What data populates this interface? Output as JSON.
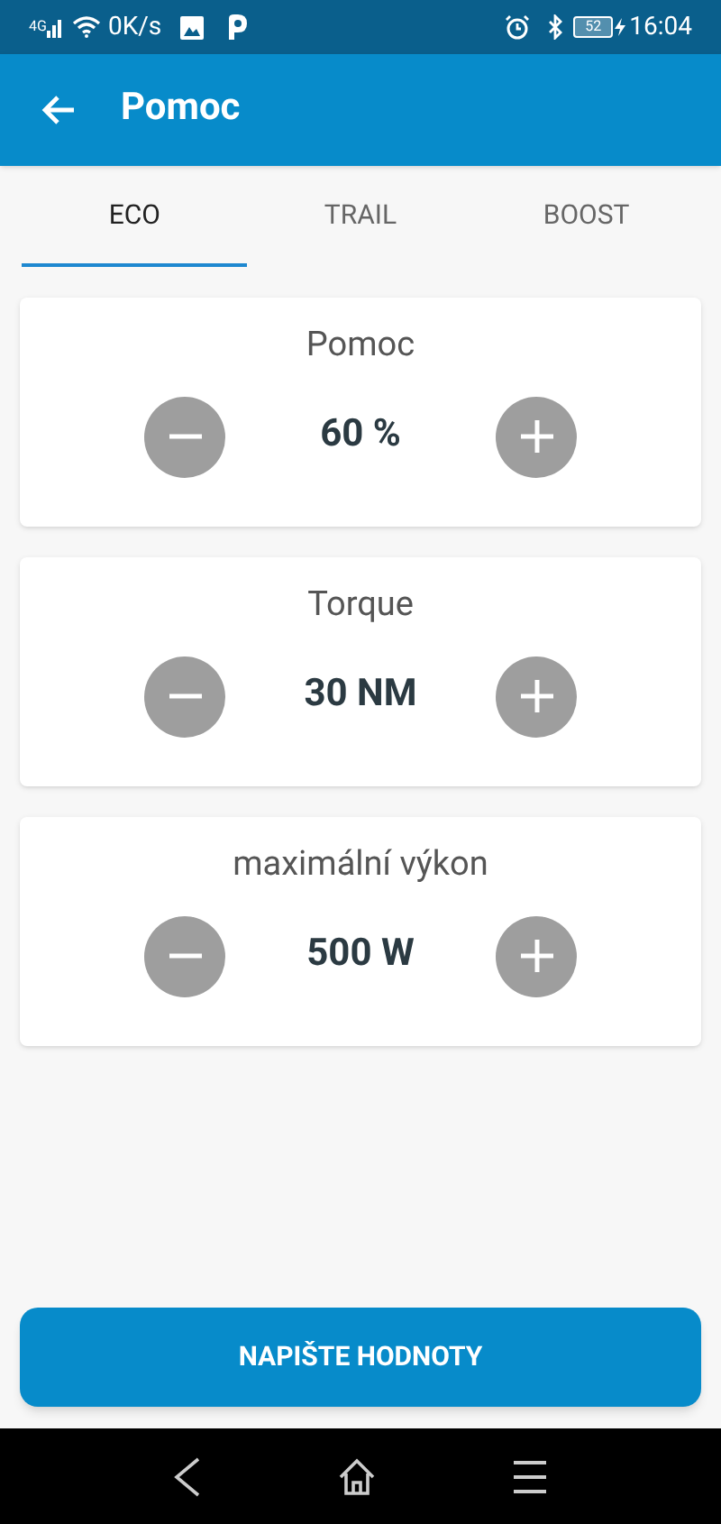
{
  "status_bar": {
    "network": "4G",
    "speed": "0K/s",
    "battery": "52",
    "time": "16:04"
  },
  "app_bar": {
    "title": "Pomoc"
  },
  "tabs": [
    {
      "label": "ECO",
      "selected": true
    },
    {
      "label": "TRAIL",
      "selected": false
    },
    {
      "label": "BOOST",
      "selected": false
    }
  ],
  "settings": [
    {
      "label": "Pomoc",
      "value": "60 %"
    },
    {
      "label": "Torque",
      "value": "30 NM"
    },
    {
      "label": "maximální výkon",
      "value": "500 W"
    }
  ],
  "submit_button": "NAPIŠTE HODNOTY"
}
